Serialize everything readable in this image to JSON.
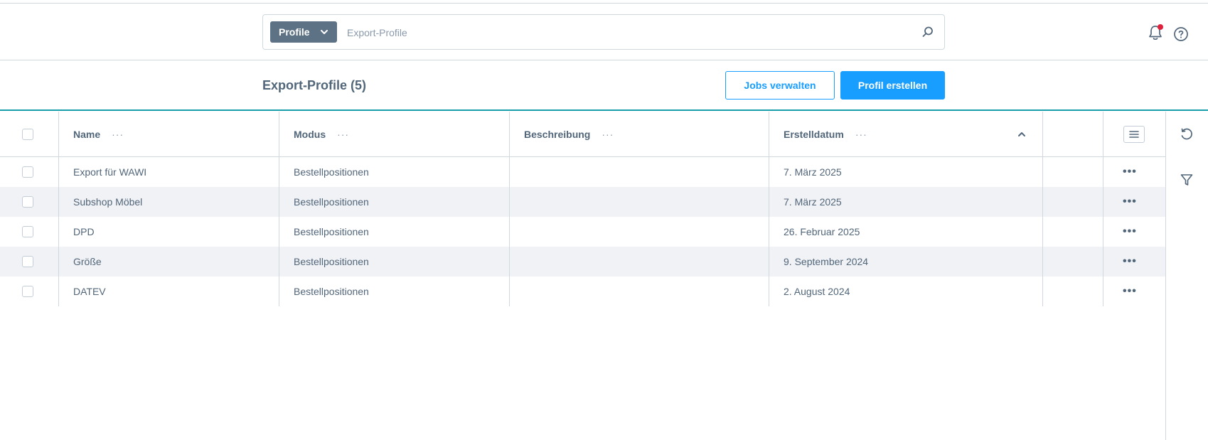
{
  "header": {
    "search": {
      "type_label": "Profile",
      "placeholder": "Export-Profile",
      "value": ""
    },
    "icons": [
      "search-icon",
      "bell-icon",
      "help-icon"
    ],
    "notification_dot_color": "#e0213d"
  },
  "page": {
    "title": "Export-Profile (5)",
    "buttons": {
      "manage_jobs": "Jobs verwalten",
      "create_profile": "Profil erstellen"
    },
    "accent_color": "#189eff",
    "divider_color": "#189eab"
  },
  "grid": {
    "columns": [
      {
        "label": "Name"
      },
      {
        "label": "Modus"
      },
      {
        "label": "Beschreibung"
      },
      {
        "label": "Erstelldatum",
        "sort": "ascending"
      }
    ],
    "rows": [
      {
        "name": "Export für WAWI",
        "mode": "Bestellpositionen",
        "description": "",
        "created": "7. März 2025"
      },
      {
        "name": "Subshop Möbel",
        "mode": "Bestellpositionen",
        "description": "",
        "created": "7. März 2025"
      },
      {
        "name": "DPD",
        "mode": "Bestellpositionen",
        "description": "",
        "created": "26. Februar 2025"
      },
      {
        "name": "Größe",
        "mode": "Bestellpositionen",
        "description": "",
        "created": "9. September 2024"
      },
      {
        "name": "DATEV",
        "mode": "Bestellpositionen",
        "description": "",
        "created": "2. August 2024"
      }
    ],
    "context_menu_glyph": "···",
    "row_action_glyph": "•••"
  },
  "sidebar": {
    "icons": [
      "refresh-icon",
      "filter-icon"
    ]
  }
}
